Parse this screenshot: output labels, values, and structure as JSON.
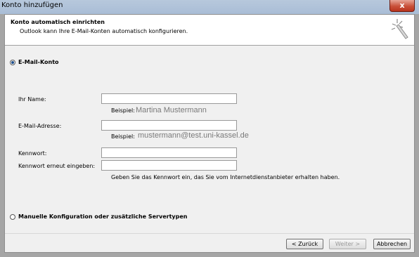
{
  "window": {
    "title": "Konto hinzufügen",
    "close_glyph": "x"
  },
  "header": {
    "title": "Konto automatisch einrichten",
    "subtitle": "Outlook kann Ihre E-Mail-Konten automatisch konfigurieren.",
    "icon": "magic-wand-icon"
  },
  "options": {
    "email_account": {
      "label": "E-Mail-Konto",
      "selected": true
    },
    "manual_config": {
      "label": "Manuelle Konfiguration oder zusätzliche Servertypen",
      "selected": false
    }
  },
  "form": {
    "name": {
      "label": "Ihr Name:",
      "value": "",
      "example_label": "Beispiel:",
      "example_value": "Martina Mustermann"
    },
    "email": {
      "label": "E-Mail-Adresse:",
      "value": "",
      "example_label": "Beispiel:",
      "example_value": "mustermann@test.uni-kassel.de"
    },
    "password": {
      "label": "Kennwort:",
      "value": ""
    },
    "password_repeat": {
      "label": "Kennwort erneut eingeben:",
      "value": ""
    },
    "password_hint": "Geben Sie das Kennwort ein, das Sie vom Internetdienstanbieter erhalten haben."
  },
  "buttons": {
    "back": "< Zurück",
    "next": "Weiter >",
    "cancel": "Abbrechen"
  }
}
